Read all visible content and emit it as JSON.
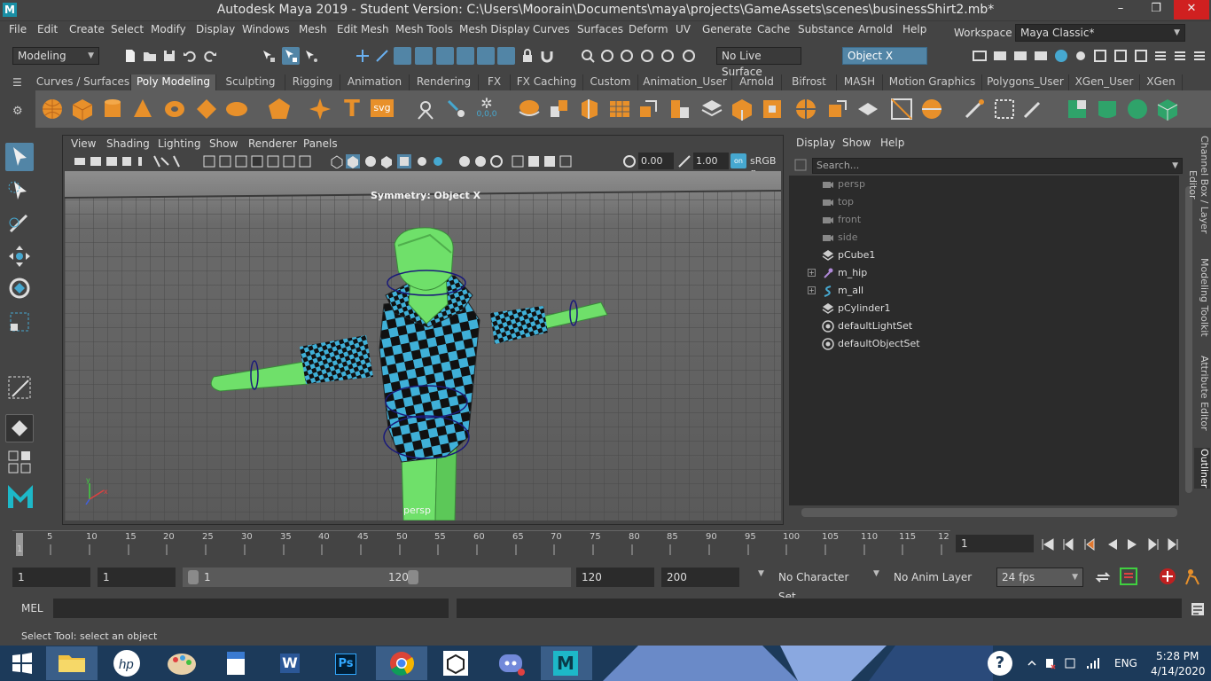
{
  "window": {
    "title": "Autodesk Maya 2019 - Student Version: C:\\Users\\Moorain\\Documents\\maya\\projects\\GameAssets\\scenes\\businessShirt2.mb*",
    "logo": "M",
    "minimize": "–",
    "maximize": "❐",
    "close": "✕"
  },
  "menubar": {
    "items": [
      "File",
      "Edit",
      "Create",
      "Select",
      "Modify",
      "Display",
      "Windows",
      "Mesh",
      "Edit Mesh",
      "Mesh Tools",
      "Mesh Display",
      "Curves",
      "Surfaces",
      "Deform",
      "UV",
      "Generate",
      "Cache",
      "Substance",
      "Arnold",
      "Help"
    ],
    "workspace_label": "Workspace :",
    "workspace_value": "Maya Classic*"
  },
  "statusline": {
    "menuset": "Modeling",
    "live_surface": "No Live Surface",
    "symmetry": "Object X"
  },
  "shelf": {
    "tabs": [
      "Curves / Surfaces",
      "Poly Modeling",
      "Sculpting",
      "Rigging",
      "Animation",
      "Rendering",
      "FX",
      "FX Caching",
      "Custom",
      "Animation_User",
      "Arnold",
      "Bifrost",
      "MASH",
      "Motion Graphics",
      "Polygons_User",
      "XGen_User",
      "XGen"
    ],
    "active_tab": "Poly Modeling",
    "text_icon": "T",
    "svg_icon": "svg",
    "sphere_label": "0,0,0"
  },
  "viewport": {
    "menu": [
      "View",
      "Shading",
      "Lighting",
      "Show",
      "Renderer",
      "Panels"
    ],
    "exposure": "0.00",
    "gamma": "1.00",
    "colorspace": "sRGB g",
    "symmetry_label": "Symmetry: Object X",
    "camera_label": "persp",
    "axis_x": "x",
    "axis_y": "y"
  },
  "outliner": {
    "menu": [
      "Display",
      "Show",
      "Help"
    ],
    "search_placeholder": "Search...",
    "items": [
      {
        "label": "persp",
        "type": "camera",
        "expandable": false,
        "dim": true
      },
      {
        "label": "top",
        "type": "camera",
        "expandable": false,
        "dim": true
      },
      {
        "label": "front",
        "type": "camera",
        "expandable": false,
        "dim": true
      },
      {
        "label": "side",
        "type": "camera",
        "expandable": false,
        "dim": true
      },
      {
        "label": "pCube1",
        "type": "mesh",
        "expandable": false,
        "dim": false
      },
      {
        "label": "m_hip",
        "type": "joint",
        "expandable": true,
        "dim": false
      },
      {
        "label": "m_all",
        "type": "curve",
        "expandable": true,
        "dim": false
      },
      {
        "label": "pCylinder1",
        "type": "mesh",
        "expandable": false,
        "dim": false
      },
      {
        "label": "defaultLightSet",
        "type": "set",
        "expandable": false,
        "dim": false
      },
      {
        "label": "defaultObjectSet",
        "type": "set",
        "expandable": false,
        "dim": false
      }
    ]
  },
  "side_tabs": [
    "Channel Box / Layer Editor",
    "Modeling Toolkit",
    "Attribute Editor",
    "Outliner"
  ],
  "timeline": {
    "ticks": [
      "5",
      "10",
      "15",
      "20",
      "25",
      "30",
      "35",
      "40",
      "45",
      "50",
      "55",
      "60",
      "65",
      "70",
      "75",
      "80",
      "85",
      "90",
      "95",
      "100",
      "105",
      "110",
      "115",
      "12"
    ],
    "current_start": "1",
    "current_frame": "1"
  },
  "range": {
    "start": "1",
    "anim_start": "1",
    "slider_start": "1",
    "slider_end": "120",
    "end": "120",
    "anim_end": "200",
    "character_set": "No Character Set",
    "anim_layer": "No Anim Layer",
    "fps": "24 fps"
  },
  "command": {
    "mel_label": "MEL",
    "help_text": "Select Tool: select an object"
  },
  "taskbar": {
    "language": "ENG",
    "time": "5:28 PM",
    "date": "4/14/2020",
    "help_icon": "?",
    "ps_label": "Ps",
    "word_label": "W",
    "maya_label": "M"
  },
  "colors": {
    "accent": "#5285a6",
    "shelf_bg": "#5d5d5d",
    "ui_bg": "#444444",
    "field_bg": "#2b2b2b",
    "character_green": "#6fe06a",
    "checker_blue": "#3fb0d8"
  }
}
